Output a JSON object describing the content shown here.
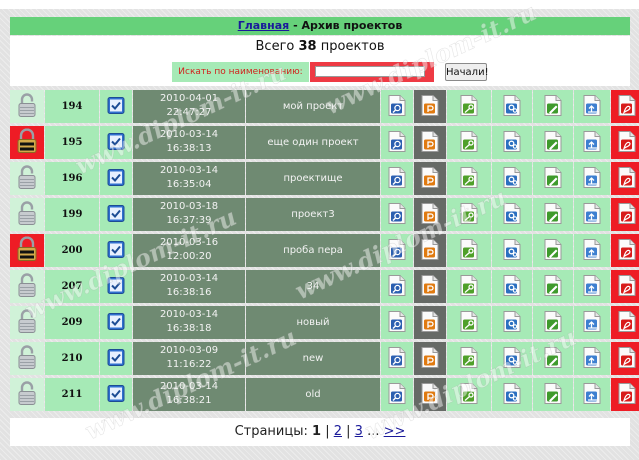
{
  "header": {
    "home_link": "Главная",
    "separator": " - ",
    "title": "Архив проектов"
  },
  "summary": {
    "prefix": "Всего",
    "count": "38",
    "suffix": "проектов"
  },
  "search": {
    "label": "Искать по наименованию:",
    "value": "",
    "button": "Начали!"
  },
  "rows": [
    {
      "id": "194",
      "locked": false,
      "date": "2010-04-01",
      "time": "22:47:27",
      "name": "мой проект"
    },
    {
      "id": "195",
      "locked": true,
      "date": "2010-03-14",
      "time": "16:38:13",
      "name": "еще один проект"
    },
    {
      "id": "196",
      "locked": false,
      "date": "2010-03-14",
      "time": "16:35:04",
      "name": "проектище"
    },
    {
      "id": "199",
      "locked": false,
      "date": "2010-03-18",
      "time": "16:37:39",
      "name": "проект3"
    },
    {
      "id": "200",
      "locked": true,
      "date": "2010-03-16",
      "time": "12:00:20",
      "name": "проба пера"
    },
    {
      "id": "207",
      "locked": false,
      "date": "2010-03-14",
      "time": "16:38:16",
      "name": "34"
    },
    {
      "id": "209",
      "locked": false,
      "date": "2010-03-14",
      "time": "16:38:18",
      "name": "новый"
    },
    {
      "id": "210",
      "locked": false,
      "date": "2010-03-09",
      "time": "11:16:22",
      "name": "new"
    },
    {
      "id": "211",
      "locked": false,
      "date": "2010-03-14",
      "time": "16:38:21",
      "name": "old"
    }
  ],
  "row_icons": [
    "lock-icon",
    "checkbox-icon",
    "search-document-icon",
    "powerpoint-document-icon",
    "key-document-icon",
    "settings-document-icon",
    "edit-document-icon",
    "upload-document-icon",
    "pdf-document-icon"
  ],
  "pagination": {
    "label": "Страницы:",
    "current": "1",
    "pages": [
      "2",
      "3"
    ],
    "ellipsis": "...",
    "next": ">>"
  },
  "watermark": "www.diplom-it.ru",
  "colors": {
    "header_green": "#66d17a",
    "cell_green": "#a6eab6",
    "cell_dark": "#6f8a72",
    "locked_red": "#ee1c25",
    "link_blue": "#1a1a9a"
  }
}
